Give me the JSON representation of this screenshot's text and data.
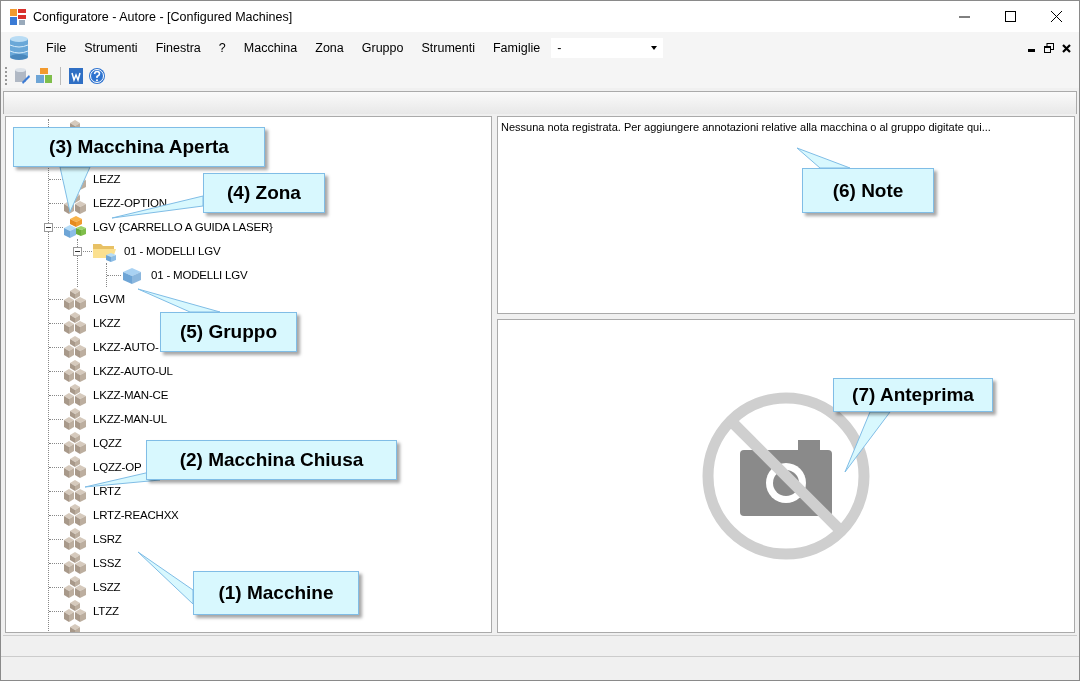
{
  "window": {
    "title": "Configuratore - Autore - [Configured Machines]"
  },
  "menu": [
    "File",
    "Strumenti",
    "Finestra",
    "?",
    "Macchina",
    "Zona",
    "Gruppo",
    "Strumenti",
    "Famiglie"
  ],
  "family_combo": {
    "value": "-"
  },
  "tree": {
    "items": [
      {
        "kind": "machine",
        "expanded": false
      },
      {
        "kind": "machine",
        "label": "LEZZ",
        "expanded": false
      },
      {
        "kind": "machine",
        "label": "LEZZ-OPTION",
        "expanded": false
      },
      {
        "kind": "machine",
        "label": "LGV {CARRELLO A GUIDA LASER}",
        "expanded": true,
        "children": [
          {
            "kind": "zone",
            "label": "01 - MODELLI LGV",
            "expanded": true,
            "children": [
              {
                "kind": "group",
                "label": "01 - MODELLI LGV"
              }
            ]
          }
        ]
      },
      {
        "kind": "machine",
        "label": "LGVM",
        "expanded": false
      },
      {
        "kind": "machine",
        "label": "LKZZ",
        "expanded": false
      },
      {
        "kind": "machine",
        "label": "LKZZ-AUTO-",
        "expanded": false
      },
      {
        "kind": "machine",
        "label": "LKZZ-AUTO-UL",
        "expanded": false
      },
      {
        "kind": "machine",
        "label": "LKZZ-MAN-CE",
        "expanded": false
      },
      {
        "kind": "machine",
        "label": "LKZZ-MAN-UL",
        "expanded": false
      },
      {
        "kind": "machine",
        "label": "LQZZ",
        "expanded": false
      },
      {
        "kind": "machine",
        "label": "LQZZ-OP",
        "expanded": false
      },
      {
        "kind": "machine",
        "label": "LRTZ",
        "expanded": false
      },
      {
        "kind": "machine",
        "label": "LRTZ-REACHXX",
        "expanded": false
      },
      {
        "kind": "machine",
        "label": "LSRZ",
        "expanded": false
      },
      {
        "kind": "machine",
        "label": "LSSZ",
        "expanded": false
      },
      {
        "kind": "machine",
        "label": "LSZZ",
        "expanded": false
      },
      {
        "kind": "machine",
        "label": "LTZZ",
        "expanded": false
      },
      {
        "kind": "machine",
        "expanded": false
      }
    ]
  },
  "notes": {
    "placeholder": "Nessuna nota registrata. Per aggiungere annotazioni relative alla macchina o al gruppo digitate qui..."
  },
  "callouts": [
    {
      "text": "(3) Macchina Aperta"
    },
    {
      "text": "(4) Zona"
    },
    {
      "text": "(5) Gruppo"
    },
    {
      "text": "(2) Macchina Chiusa"
    },
    {
      "text": "(1) Macchine"
    },
    {
      "text": "(6) Note"
    },
    {
      "text": "(7) Anteprima"
    }
  ]
}
